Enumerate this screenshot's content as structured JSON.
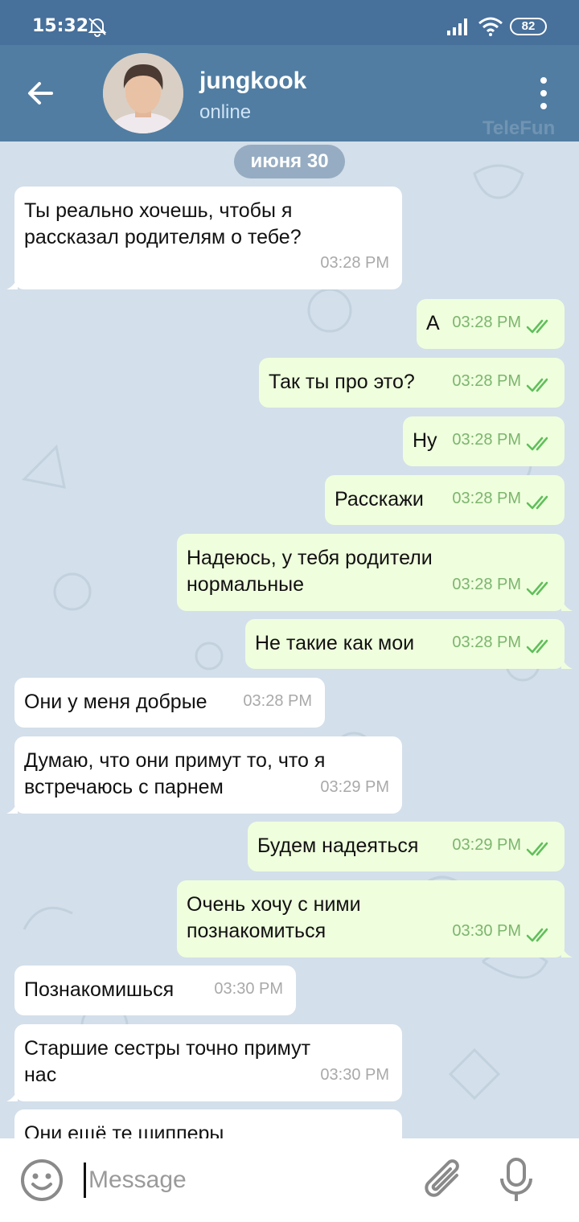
{
  "status_bar": {
    "time": "15:32",
    "battery": "82",
    "icons": [
      "bell-off-icon",
      "signal-icon",
      "wifi-icon",
      "battery-icon"
    ]
  },
  "header": {
    "name": "jungkook",
    "status": "online",
    "watermark": "TeleFun",
    "icons": [
      "back-arrow-icon",
      "more-vertical-icon"
    ]
  },
  "chat": {
    "date_label": "июня 30",
    "messages": [
      {
        "dir": "in",
        "text": "Ты реально хочешь, чтобы я\nрассказал родителям о тебе?",
        "time": "03:28 PM"
      },
      {
        "dir": "out",
        "text": "А",
        "time": "03:28 PM"
      },
      {
        "dir": "out",
        "text": "Так ты про это?",
        "time": "03:28 PM"
      },
      {
        "dir": "out",
        "text": "Ну",
        "time": "03:28 PM"
      },
      {
        "dir": "out",
        "text": "Расскажи",
        "time": "03:28 PM"
      },
      {
        "dir": "out",
        "text": "Надеюсь, у тебя родители\nнормальные",
        "time": "03:28 PM"
      },
      {
        "dir": "out",
        "text": "Не такие как мои",
        "time": "03:28 PM"
      },
      {
        "dir": "in",
        "text": "Они у меня добрые",
        "time": "03:28 PM"
      },
      {
        "dir": "in",
        "text": "Думаю, что они примут то, что я\nвстречаюсь с парнем",
        "time": "03:29 PM"
      },
      {
        "dir": "out",
        "text": "Будем надеяться",
        "time": "03:29 PM"
      },
      {
        "dir": "out",
        "text": "Очень хочу с ними\nпознакомиться",
        "time": "03:30 PM"
      },
      {
        "dir": "in",
        "text": "Познакомишься",
        "time": "03:30 PM"
      },
      {
        "dir": "in",
        "text": "Старшие сестры точно примут\nнас",
        "time": "03:30 PM"
      },
      {
        "dir": "in",
        "text": "Они ещё те шипперы",
        "time": ""
      }
    ]
  },
  "composer": {
    "placeholder": "Message",
    "icons": [
      "emoji-icon",
      "attach-icon",
      "mic-icon"
    ]
  },
  "colors": {
    "status_bar": "#47709b",
    "header": "#517da2",
    "chat_bg": "#d3dfea",
    "incoming": "#ffffff",
    "outgoing": "#effedd",
    "read_ticks": "#5fbf5a"
  }
}
